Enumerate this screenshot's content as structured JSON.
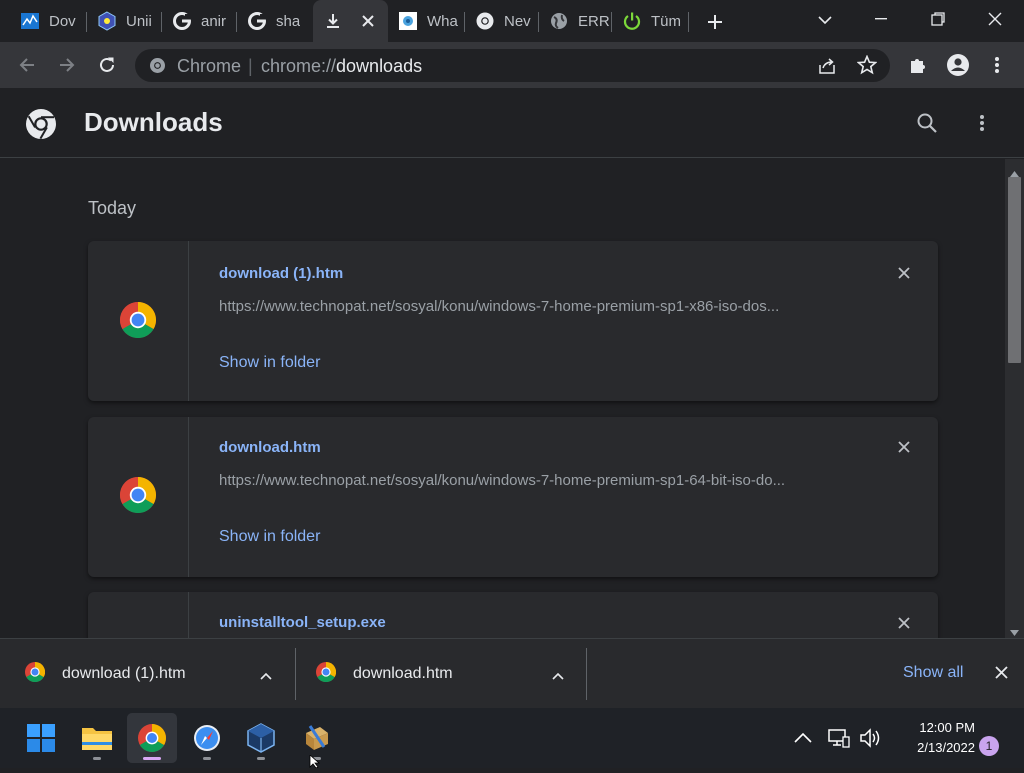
{
  "tabs": [
    {
      "label": "Dov",
      "icon": "windows-blue-icon"
    },
    {
      "label": "Unii",
      "icon": "uninstall-tool-icon"
    },
    {
      "label": "anir",
      "icon": "google-icon"
    },
    {
      "label": "sha",
      "icon": "google-icon"
    },
    {
      "label": "",
      "icon": "download-icon",
      "active": true
    },
    {
      "label": "Wha",
      "icon": "site-favicon-icon"
    },
    {
      "label": "Nev",
      "icon": "chrome-icon"
    },
    {
      "label": "ERR",
      "icon": "globe-icon"
    },
    {
      "label": "Tüm",
      "icon": "power-icon"
    }
  ],
  "omnibox": {
    "site_label": "Chrome",
    "separator": "|",
    "url_prefix": "chrome://",
    "url_path": "downloads"
  },
  "page": {
    "title": "Downloads",
    "section_today": "Today"
  },
  "downloads": [
    {
      "name": "download (1).htm",
      "url": "https://www.technopat.net/sosyal/konu/windows-7-home-premium-sp1-x86-iso-dos...",
      "action": "Show in folder"
    },
    {
      "name": "download.htm",
      "url": "https://www.technopat.net/sosyal/konu/windows-7-home-premium-sp1-64-bit-iso-do...",
      "action": "Show in folder"
    },
    {
      "name": "uninstalltool_setup.exe",
      "url": "",
      "action": ""
    }
  ],
  "shelf": {
    "items": [
      "download (1).htm",
      "download.htm"
    ],
    "show_all": "Show all"
  },
  "taskbar": {
    "time": "12:00 PM",
    "date": "2/13/2022",
    "notifications": "1"
  },
  "colors": {
    "accent": "#8ab4f8",
    "background": "#202124",
    "card": "#292a2d"
  }
}
